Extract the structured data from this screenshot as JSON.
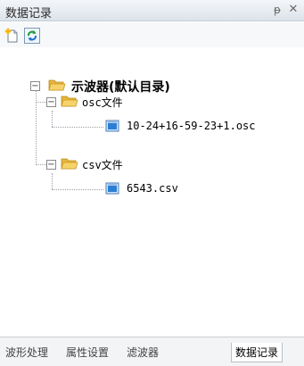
{
  "window": {
    "title": "数据记录",
    "pin_glyph": "ᵽ",
    "close_glyph": "✕"
  },
  "toolbar": {
    "icons": [
      "new-file-icon",
      "refresh-icon"
    ]
  },
  "tree": {
    "root": {
      "label": "示波器(默认目录)",
      "expanded": true
    },
    "folders": [
      {
        "label": "osc文件",
        "files": [
          "10-24+16-59-23+1.osc"
        ]
      },
      {
        "label": "csv文件",
        "files": [
          "6543.csv"
        ]
      }
    ]
  },
  "tabs": [
    {
      "label": "波形处理",
      "active": false
    },
    {
      "label": "属性设置",
      "active": false
    },
    {
      "label": "滤波器",
      "active": false
    },
    {
      "label": "数据记录",
      "active": true
    }
  ],
  "colors": {
    "titlebar": "#dde3ea",
    "folder": "#f0c64a",
    "accent": "#2a7fd4"
  }
}
